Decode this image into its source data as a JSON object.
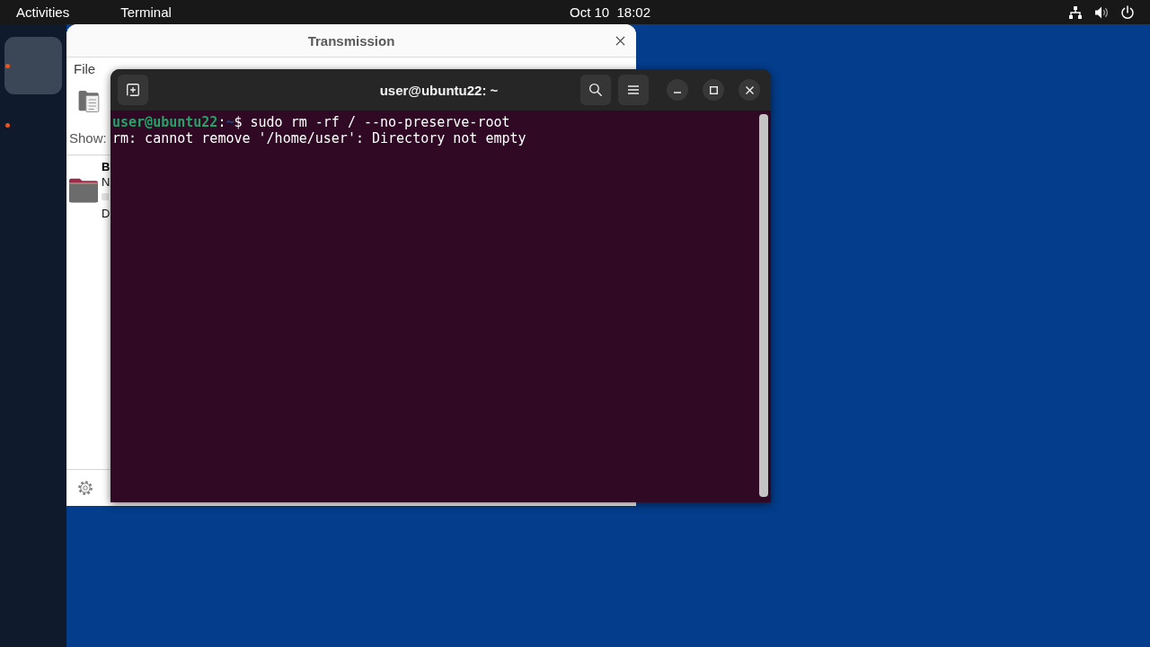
{
  "top_bar": {
    "activities": "Activities",
    "app_menu": "Terminal",
    "clock": "Oct 10  18:02"
  },
  "dock": {
    "items": [
      {
        "selected": true,
        "running": true
      },
      {
        "selected": false,
        "running": true
      }
    ]
  },
  "transmission": {
    "title": "Transmission",
    "menu": [
      "File"
    ],
    "filter_label": "Show:",
    "torrents": [
      {
        "name": "B",
        "status": "N",
        "details": "D"
      }
    ]
  },
  "terminal": {
    "title": "user@ubuntu22: ~",
    "lines": [
      {
        "kind": "prompt",
        "user_host": "user@ubuntu22",
        "separator": ":",
        "path": "~",
        "symbol": "$",
        "command": "sudo rm -rf / --no-preserve-root"
      },
      {
        "kind": "output",
        "text": "rm: cannot remove '/home/user': Directory not empty"
      }
    ]
  }
}
